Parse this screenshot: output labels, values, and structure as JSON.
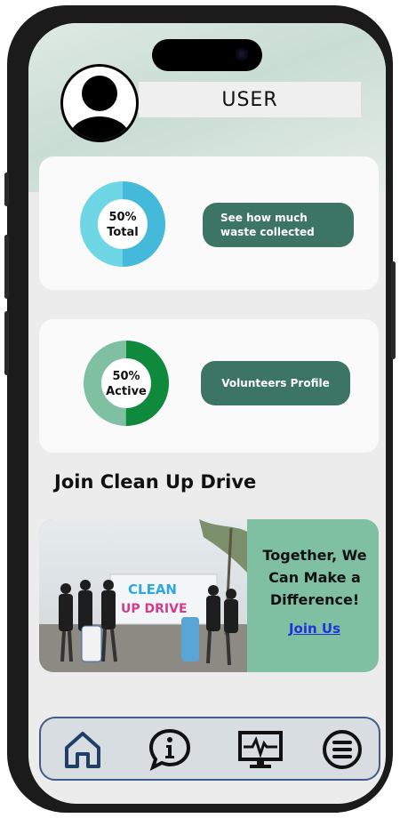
{
  "header": {
    "username": "USER"
  },
  "cards": [
    {
      "percent_label": "50%",
      "status_label": "Total",
      "button_label": "See how much waste collected",
      "ring_fraction": 0.5
    },
    {
      "percent_label": "50%",
      "status_label": "Active",
      "button_label": "Volunteers Profile",
      "ring_fraction": 0.5
    }
  ],
  "section": {
    "title": "Join Clean Up Drive"
  },
  "promo": {
    "tagline": "Together, We Can Make a Difference!",
    "link_label": "Join Us",
    "banner_text": "CLEAN UP DRIVE"
  },
  "nav": {
    "items": [
      {
        "icon": "home-icon"
      },
      {
        "icon": "info-icon"
      },
      {
        "icon": "monitor-icon"
      },
      {
        "icon": "menu-icon"
      }
    ]
  },
  "colors": {
    "accent": "#3c7563",
    "donut1_primary": "#45b9d9",
    "donut1_secondary": "#6fd6e6",
    "donut2_primary": "#0f8a3c",
    "donut2_secondary": "#7fc0a2",
    "nav_icon": "#1f3f66",
    "promo_bg": "#7fc0a2"
  }
}
